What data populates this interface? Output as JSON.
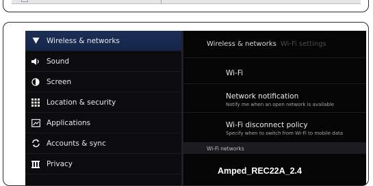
{
  "sidebar": {
    "items": [
      {
        "label": "Wireless & networks",
        "icon": "wifi-icon",
        "active": true
      },
      {
        "label": "Sound",
        "icon": "speaker-icon",
        "active": false
      },
      {
        "label": "Screen",
        "icon": "brightness-icon",
        "active": false
      },
      {
        "label": "Location & security",
        "icon": "location-grid-icon",
        "active": false
      },
      {
        "label": "Applications",
        "icon": "applications-icon",
        "active": false
      },
      {
        "label": "Accounts & sync",
        "icon": "sync-icon",
        "active": false
      },
      {
        "label": "Privacy",
        "icon": "privacy-icon",
        "active": false
      }
    ]
  },
  "content": {
    "breadcrumb": {
      "current": "Wireless & networks",
      "next": "Wi-Fi settings"
    },
    "rows": [
      {
        "title": "Wi-Fi",
        "subtitle": ""
      },
      {
        "title": "Network notification",
        "subtitle": "Notify me when an open network is available"
      },
      {
        "title": "Wi-Fi disconnect policy",
        "subtitle": "Specify when to switch from Wi-Fi to mobile data"
      }
    ],
    "section_header": "Wi-Fi networks",
    "network_name": "Amped_REC22A_2.4"
  },
  "colors": {
    "active_bg": "#1d2f57",
    "background": "#050505"
  }
}
